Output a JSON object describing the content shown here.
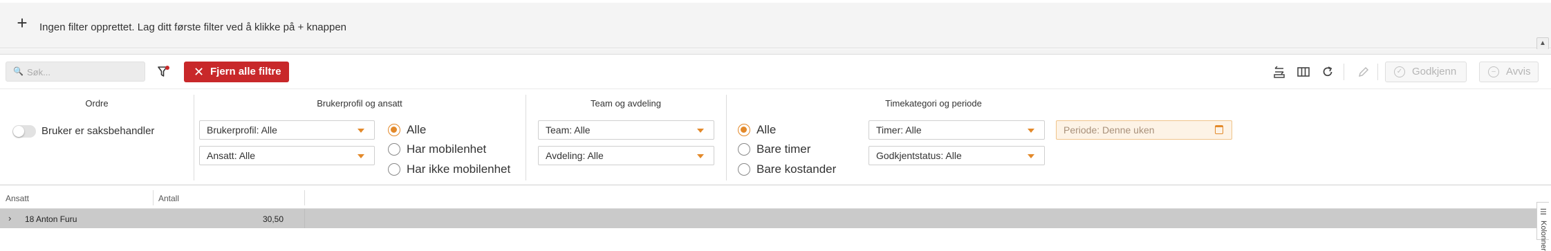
{
  "filter_banner": {
    "add_icon": "plus-icon",
    "message": "Ingen filter opprettet. Lag ditt første filter ved å klikke på + knappen",
    "collapse_icon": "chevron-up-icon"
  },
  "toolbar": {
    "search_placeholder": "Søk...",
    "clear_all_label": "Fjern alle filtre",
    "approve_label": "Godkjenn",
    "reject_label": "Avvis",
    "icons": [
      "filter-settings-icon",
      "swap-rows-icon",
      "columns-icon",
      "refresh-icon",
      "pencil-icon"
    ]
  },
  "filters": {
    "order": {
      "title": "Ordre",
      "toggle_label": "Bruker er saksbehandler",
      "toggle_on": false
    },
    "user_profile": {
      "title": "Brukerprofil og ansatt",
      "profile_select": "Brukerprofil: Alle",
      "employee_select": "Ansatt: Alle",
      "radio_options": [
        "Alle",
        "Har mobilenhet",
        "Har ikke mobilenhet"
      ],
      "radio_selected": "Alle"
    },
    "team": {
      "title": "Team og avdeling",
      "team_select": "Team: Alle",
      "department_select": "Avdeling: Alle"
    },
    "time_category": {
      "title": "Timekategori og periode",
      "radio_options": [
        "Alle",
        "Bare timer",
        "Bare kostander"
      ],
      "radio_selected": "Alle",
      "hours_select": "Timer: Alle",
      "approval_select": "Godkjentstatus: Alle",
      "period_select": "Periode: Denne uken"
    }
  },
  "grid": {
    "columns": [
      "Ansatt",
      "Antall"
    ],
    "rows": [
      {
        "employee": "18 Anton Furu",
        "amount": "30,50"
      }
    ],
    "side_tab_label": "Kolonner"
  },
  "colors": {
    "accent": "#e3892a",
    "danger": "#c8282a"
  }
}
